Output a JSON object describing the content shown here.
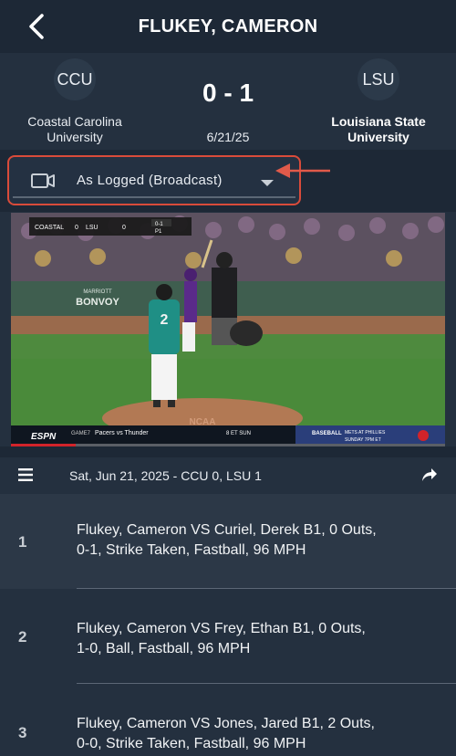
{
  "header": {
    "title": "FLUKEY, CAMERON"
  },
  "game": {
    "away": {
      "abbr": "CCU",
      "name_line1": "Coastal Carolina",
      "name_line2": "University"
    },
    "home": {
      "abbr": "LSU",
      "name_line1": "Louisiana State",
      "name_line2": "University"
    },
    "score": "0 - 1",
    "date": "6/21/25"
  },
  "controls": {
    "view_mode": "As Logged (Broadcast)"
  },
  "video": {
    "bug_away": "COASTAL",
    "bug_away_score": "0",
    "bug_home": "LSU",
    "bug_home_score": "0",
    "bug_count": "0-1",
    "bug_outs": "P1",
    "bottom_left_brand": "ESPN",
    "bottom_game": "GAME7",
    "bottom_teams": "Pacers vs Thunder",
    "bottom_time": "8 ET SUN",
    "ad_line1": "BASEBALL",
    "ad_line2": "METS AT PHILLIES",
    "ad_line3": "SUNDAY 7PM ET",
    "wall_text": "BONVOY",
    "wall_text_small": "MARRIOTT",
    "mound_text": "NCAA",
    "jersey_number": "2",
    "progress_fraction": 0.15
  },
  "playbar": {
    "text": "Sat, Jun 21, 2025 - CCU 0, LSU 1"
  },
  "pitches": [
    {
      "num": "1",
      "line1": "Flukey, Cameron VS Curiel, Derek B1, 0 Outs,",
      "line2": "0-1, Strike Taken, Fastball, 96 MPH"
    },
    {
      "num": "2",
      "line1": "Flukey, Cameron VS Frey, Ethan B1, 0 Outs,",
      "line2": "1-0, Ball, Fastball, 96 MPH"
    },
    {
      "num": "3",
      "line1": "Flukey, Cameron VS Jones, Jared B1, 2 Outs,",
      "line2": "0-0, Strike Taken, Fastball, 96 MPH"
    }
  ],
  "colors": {
    "accent_red": "#d94b3a",
    "header_bg": "#1d2836",
    "panel_bg": "#24303f",
    "row_alt": "#2c3847"
  },
  "icons": {
    "back": "back-arrow-icon",
    "camera": "video-camera-icon",
    "settings": "gear-icon",
    "menu": "menu-icon",
    "share": "share-icon"
  }
}
